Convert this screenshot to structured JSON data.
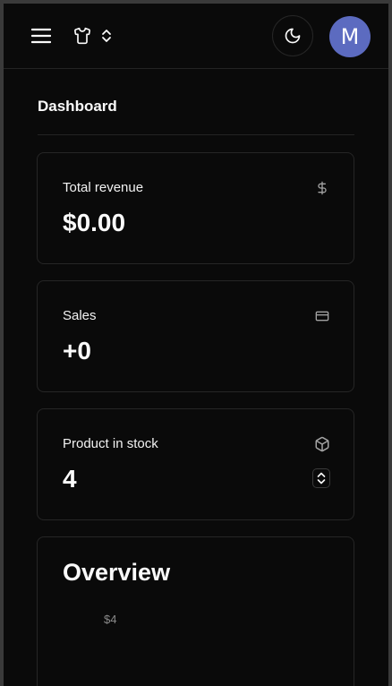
{
  "header": {
    "avatar_initial": "M",
    "accent_color": "#5c6bc0"
  },
  "page": {
    "title": "Dashboard"
  },
  "cards": [
    {
      "label": "Total revenue",
      "value": "$0.00",
      "icon": "dollar-sign-icon"
    },
    {
      "label": "Sales",
      "value": "+0",
      "icon": "credit-card-icon"
    },
    {
      "label": "Product in stock",
      "value": "4",
      "icon": "package-icon"
    }
  ],
  "overview": {
    "title": "Overview"
  },
  "chart_data": {
    "type": "bar",
    "title": "Overview",
    "ytick_labels": [
      "$4"
    ]
  }
}
